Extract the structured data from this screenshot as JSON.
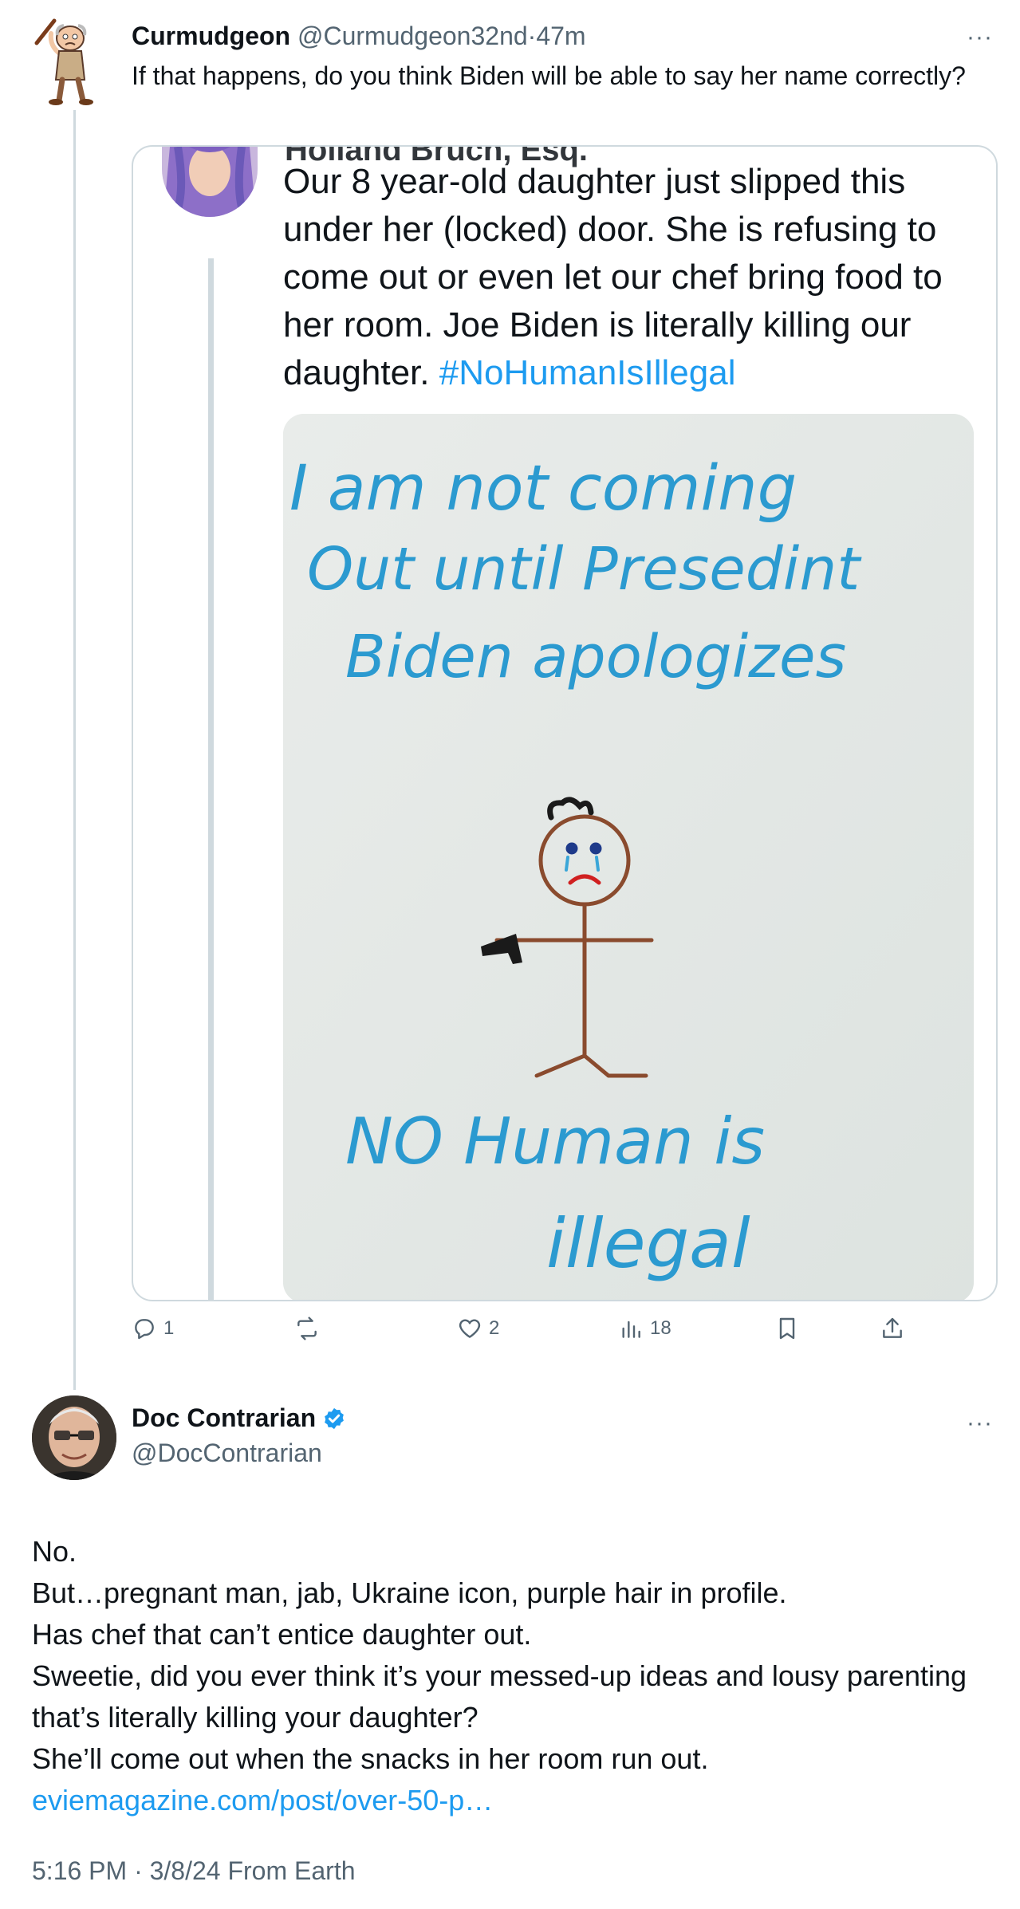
{
  "reply": {
    "display_name": "Curmudgeon",
    "handle": "@Curmudgeon32nd",
    "separator": "·",
    "time_ago": "47m",
    "text": "If that happens, do you think Biden will be able to say her name correctly?",
    "more_label": "···"
  },
  "quote": {
    "header_partial": "Holland Bruch, Esq.",
    "text": "Our 8 year-old daughter just slipped this under her (locked) door.  She is refusing to come out or even let our chef bring food to her room. Joe Biden is literally killing our daughter.",
    "hashtag": "#NoHumanIsIllegal",
    "drawing": {
      "line1": "I am not coming",
      "line2": "Out until Presedint",
      "line3": "Biden apologizes",
      "line4": "NO Human is",
      "line5": "illegal"
    }
  },
  "actions": {
    "replies": "1",
    "reposts": "",
    "likes": "2",
    "views": "18",
    "icons": [
      "reply-icon",
      "repost-icon",
      "like-icon",
      "views-icon",
      "bookmark-icon",
      "share-icon"
    ]
  },
  "tweet": {
    "display_name": "Doc Contrarian",
    "handle": "@DocContrarian",
    "verified": true,
    "more_label": "···",
    "lines": [
      "No.",
      "But…pregnant man, jab, Ukraine icon, purple hair in profile.",
      "Has chef that can’t entice daughter out.",
      "Sweetie, did you ever think it’s your messed-up ideas and lousy parenting that’s literally killing your daughter?",
      "She’ll come out when the snacks in her room run out."
    ],
    "link": "eviemagazine.com/post/over-50-p…",
    "timestamp": "5:16 PM · 3/8/24 From Earth"
  },
  "colors": {
    "text": "#0f1419",
    "secondary": "#536471",
    "accent": "#1d9bf0",
    "border": "#cfd9de",
    "drawing_ink": "#2b9ad0"
  }
}
